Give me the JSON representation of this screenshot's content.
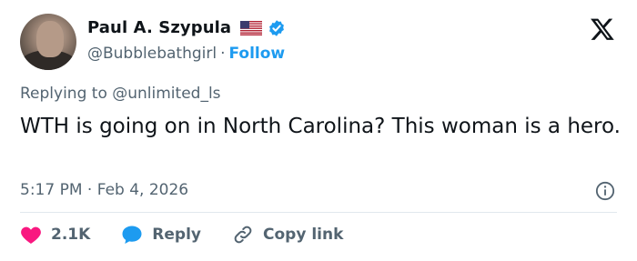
{
  "author": {
    "name": "Paul A. Szypula",
    "handle": "@Bubblebathgirl",
    "separator": "·",
    "follow_label": "Follow"
  },
  "reply": {
    "prefix": "Replying to",
    "mention": "@unlimited_ls"
  },
  "tweet": {
    "text": "WTH is going on in North Carolina? This woman is a hero.",
    "time": "5:17 PM",
    "time_sep": "·",
    "date": "Feb 4, 2026"
  },
  "actions": {
    "likes": "2.1K",
    "reply_label": "Reply",
    "copy_link_label": "Copy link"
  },
  "colors": {
    "accent": "#1d9bf0",
    "like": "#f91880",
    "muted": "#536471",
    "text": "#0f1419"
  },
  "icons": [
    "verified-icon",
    "us-flag-icon",
    "x-logo-icon",
    "info-icon",
    "heart-icon",
    "reply-bubble-icon",
    "link-icon"
  ]
}
